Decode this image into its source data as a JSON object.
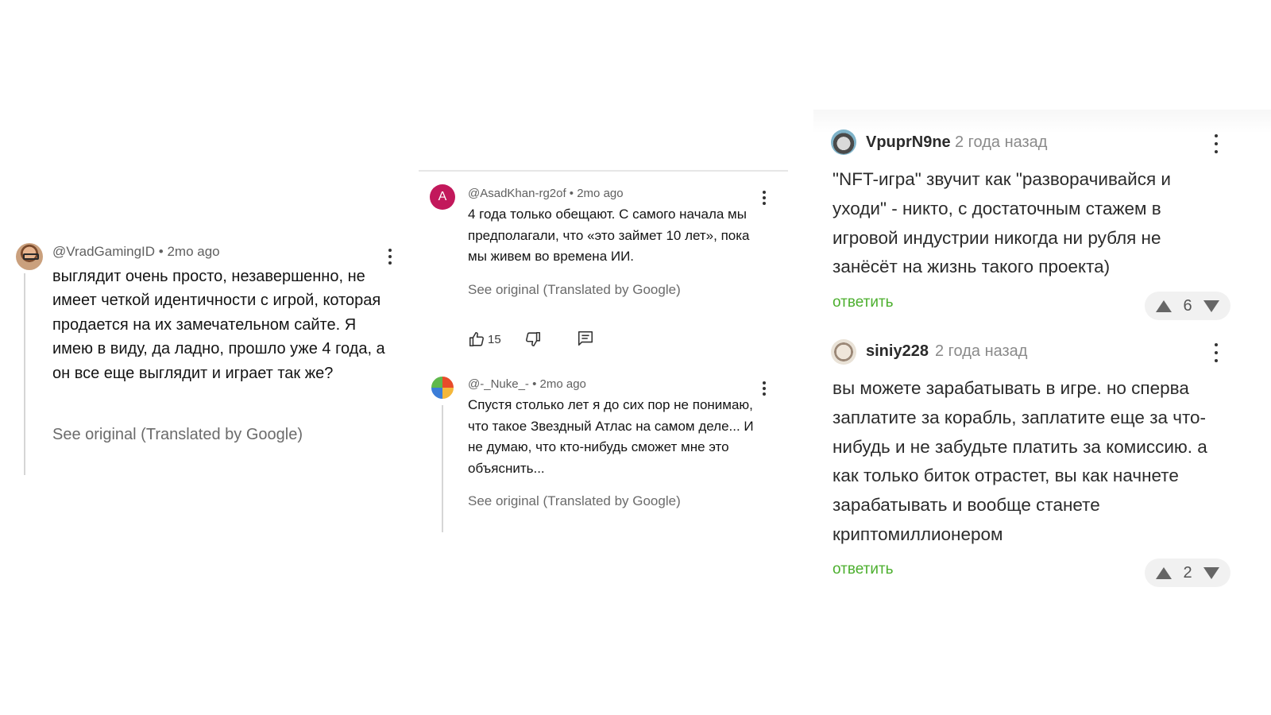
{
  "panel_youtube_1": {
    "author": "@VradGamingID",
    "time": "2mo ago",
    "meta": "@VradGamingID • 2mo ago",
    "text": "выглядит очень просто, незавершенно, не имеет четкой идентичности с игрой, которая продается на их замечательном сайте. Я имею в виду, да ладно, прошло уже 4 года, а он все еще выглядит и играет так же?",
    "see_original": "See original (Translated by Google)"
  },
  "panel_youtube_2": {
    "comment_1": {
      "avatar_letter": "A",
      "meta": "@AsadKhan-rg2of • 2mo ago",
      "text": "4 года только обещают. С самого начала мы предполагали, что «это займет 10 лет», пока мы живем во времена ИИ.",
      "see_original": "See original (Translated by Google)",
      "like_count": "15"
    },
    "comment_2": {
      "meta": "@-_Nuke_- • 2mo ago",
      "text": "Спустя столько лет я до сих пор не понимаю, что такое Звездный Атлас на самом деле... И не думаю, что кто-нибудь сможет мне это объяснить...",
      "see_original": "See original (Translated by Google)"
    }
  },
  "panel_forum": {
    "comment_1": {
      "author": "VpuprN9ne",
      "time": "2 года назад",
      "text": "\"NFT-игра\" звучит как \"разворачивайся и уходи\" - никто, с достаточным стажем в игровой индустрии никогда ни рубля не занёсёт на жизнь такого проекта)",
      "reply_label": "ответить",
      "score": "6"
    },
    "comment_2": {
      "author": "siniy228",
      "time": "2 года назад",
      "text": "вы можете зарабатывать в игре. но сперва заплатите за корабль, заплатите еще за что-нибудь и не забудьте платить за комиссию. а как только биток отрастет, вы как начнете зарабатывать и вообще станете криптомиллионером",
      "reply_label": "ответить",
      "score": "2"
    }
  },
  "colors": {
    "reply_green": "#4caf2e",
    "avatar_magenta": "#c2185b"
  }
}
